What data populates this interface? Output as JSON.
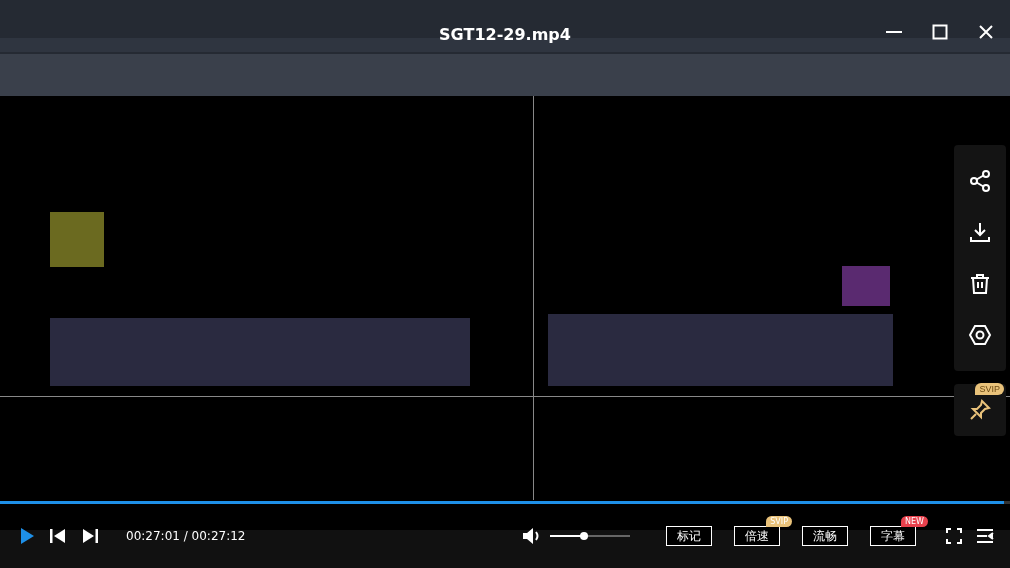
{
  "title": "SGT12-29.mp4",
  "side_panel": {
    "pin_badge": "SVIP"
  },
  "progress": {
    "level": 0.994
  },
  "time": "00:27:01 / 00:27:12",
  "volume": {
    "level": 0.43
  },
  "buttons": [
    {
      "label": "标记"
    },
    {
      "label": "倍速",
      "badge": "SVIP",
      "color": "#e9c27a"
    },
    {
      "label": "流畅"
    },
    {
      "label": "字幕",
      "badge": "NEW",
      "color": "#e8414d"
    }
  ]
}
